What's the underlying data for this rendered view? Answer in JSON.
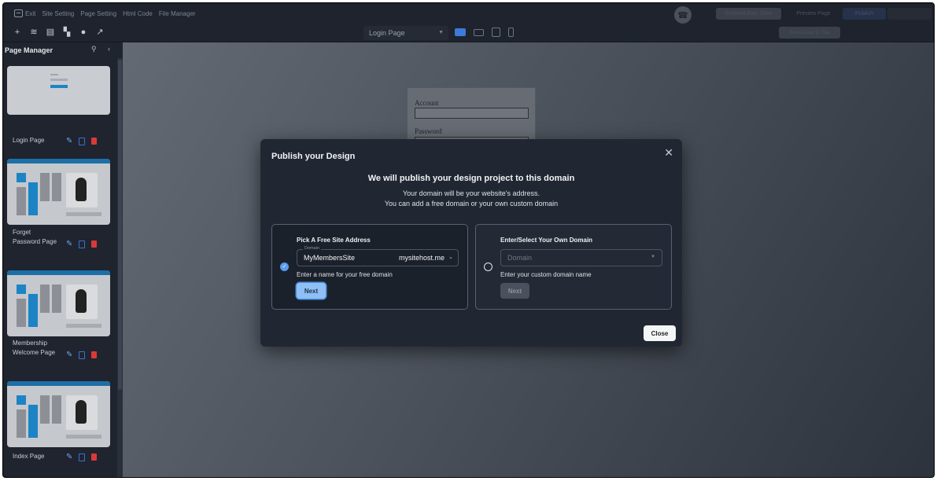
{
  "topbar": {
    "exit": "Exit",
    "menu": [
      "Site Setting",
      "Page Setting",
      "Html Code",
      "File Manager"
    ],
    "enabled_btn": "Enabled Auto Save",
    "preview_btn": "Preview Page",
    "publish_btn": "Publish",
    "extra_btn": ""
  },
  "toolbar": {
    "page_select": "Login Page",
    "reset_btn": "Reset Page to Trial"
  },
  "sidebar": {
    "title": "Page Manager",
    "pages": [
      {
        "label": "Login Page"
      },
      {
        "label": "Forget Password Page"
      },
      {
        "label": "Membership Welcome Page"
      },
      {
        "label": "Index Page"
      }
    ]
  },
  "canvas_form": {
    "account_label": "Account",
    "password_label": "Password"
  },
  "modal": {
    "title": "Publish your Design",
    "heading": "We will publish your design project to this domain",
    "sub1": "Your domain will be your website's address.",
    "sub2": "You can add a free domain or your own custom domain",
    "free": {
      "title": "Pick A Free Site Address",
      "legend": "Domain",
      "value": "MyMembersSite",
      "suffix": "mysitehost.me",
      "helper": "Enter a name for your free domain",
      "next": "Next"
    },
    "own": {
      "title": "Enter/Select Your Own Domain",
      "placeholder": "Domain",
      "helper": "Enter your custom domain name",
      "next": "Next"
    },
    "close": "Close"
  },
  "colors": {
    "accent": "#5b9cf0",
    "delete": "#d83a3a",
    "modal_bg": "#212732"
  }
}
